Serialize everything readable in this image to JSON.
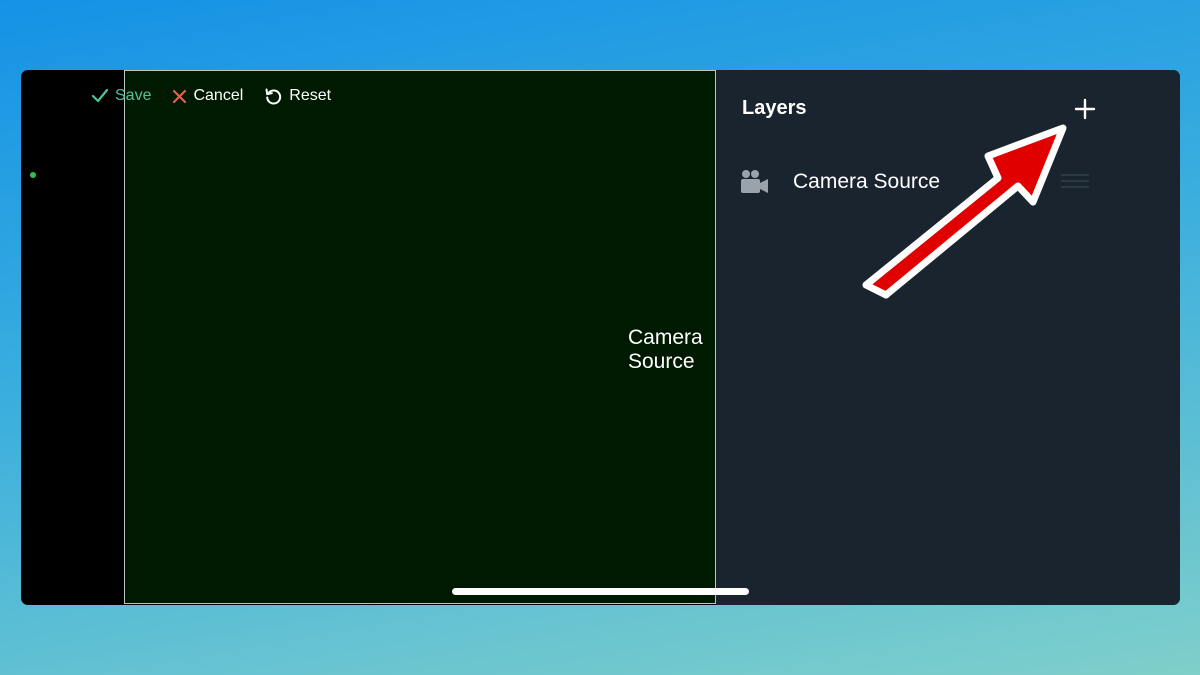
{
  "toolbar": {
    "save_label": "Save",
    "cancel_label": "Cancel",
    "reset_label": "Reset"
  },
  "preview": {
    "source_label": "Camera Source"
  },
  "layers": {
    "title": "Layers",
    "items": [
      {
        "label": "Camera Source",
        "icon": "video-camera-icon"
      }
    ]
  },
  "colors": {
    "save_accent": "#4fc29a",
    "cancel_accent": "#e8604c",
    "preview_bg": "#001a02",
    "panel_bg": "#1a242e",
    "annotation_arrow": "#e00000"
  }
}
